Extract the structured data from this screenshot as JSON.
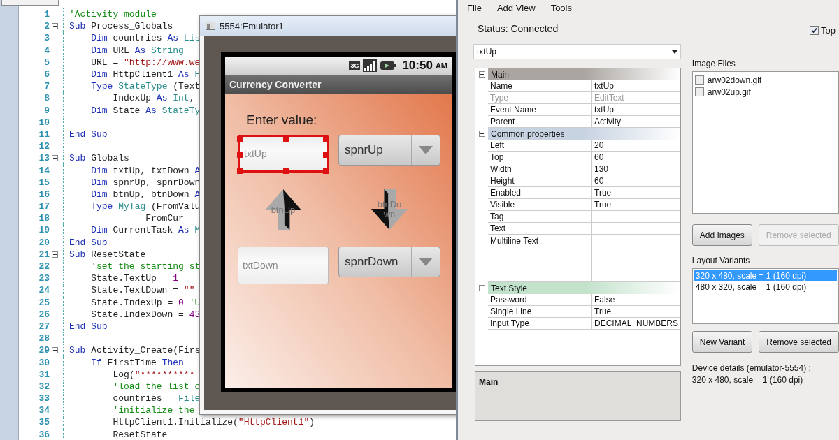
{
  "editor": {
    "lines": [
      {
        "number": "1",
        "fold": false,
        "tokens": [
          {
            "kind": "comment",
            "text": "'Activity module"
          }
        ]
      },
      {
        "number": "2",
        "fold": true,
        "tokens": [
          {
            "kind": "kw",
            "text": "Sub"
          },
          {
            "kind": "plain",
            "text": " Process_Globals"
          }
        ]
      },
      {
        "number": "3",
        "fold": false,
        "tokens": [
          {
            "kind": "kw",
            "text": "    Dim"
          },
          {
            "kind": "plain",
            "text": " countries "
          },
          {
            "kind": "kw",
            "text": "As"
          },
          {
            "kind": "type",
            "text": " Lis"
          }
        ]
      },
      {
        "number": "4",
        "fold": false,
        "tokens": [
          {
            "kind": "kw",
            "text": "    Dim"
          },
          {
            "kind": "plain",
            "text": " URL "
          },
          {
            "kind": "kw",
            "text": "As"
          },
          {
            "kind": "type",
            "text": " String"
          }
        ]
      },
      {
        "number": "5",
        "fold": false,
        "tokens": [
          {
            "kind": "plain",
            "text": "    URL = "
          },
          {
            "kind": "str",
            "text": "\"http://www.we"
          }
        ]
      },
      {
        "number": "6",
        "fold": false,
        "tokens": [
          {
            "kind": "kw",
            "text": "    Dim"
          },
          {
            "kind": "plain",
            "text": " HttpClient1 "
          },
          {
            "kind": "kw",
            "text": "As"
          },
          {
            "kind": "type",
            "text": " H"
          }
        ]
      },
      {
        "number": "7",
        "fold": false,
        "tokens": [
          {
            "kind": "kw",
            "text": "    Type"
          },
          {
            "kind": "type",
            "text": " StateType"
          },
          {
            "kind": "plain",
            "text": " (Text"
          }
        ]
      },
      {
        "number": "8",
        "fold": false,
        "tokens": [
          {
            "kind": "plain",
            "text": "        IndexUp "
          },
          {
            "kind": "kw",
            "text": "As"
          },
          {
            "kind": "type",
            "text": " Int"
          },
          {
            "kind": "plain",
            "text": ","
          }
        ]
      },
      {
        "number": "9",
        "fold": false,
        "tokens": [
          {
            "kind": "kw",
            "text": "    Dim"
          },
          {
            "kind": "plain",
            "text": " State "
          },
          {
            "kind": "kw",
            "text": "As"
          },
          {
            "kind": "type",
            "text": " StateTy"
          }
        ]
      },
      {
        "number": "10",
        "fold": false
      },
      {
        "number": "11",
        "fold": false,
        "tokens": [
          {
            "kind": "kw",
            "text": "End Sub"
          }
        ]
      },
      {
        "number": "12",
        "fold": false
      },
      {
        "number": "13",
        "fold": true,
        "tokens": [
          {
            "kind": "kw",
            "text": "Sub"
          },
          {
            "kind": "plain",
            "text": " Globals"
          }
        ]
      },
      {
        "number": "14",
        "fold": false,
        "tokens": [
          {
            "kind": "kw",
            "text": "    Dim"
          },
          {
            "kind": "plain",
            "text": " txtUp, txtDown "
          },
          {
            "kind": "kw",
            "text": "A"
          }
        ]
      },
      {
        "number": "15",
        "fold": false,
        "tokens": [
          {
            "kind": "kw",
            "text": "    Dim"
          },
          {
            "kind": "plain",
            "text": " spnrUp, spnrDown"
          }
        ]
      },
      {
        "number": "16",
        "fold": false,
        "tokens": [
          {
            "kind": "kw",
            "text": "    Dim"
          },
          {
            "kind": "plain",
            "text": " btnUp, btnDown "
          },
          {
            "kind": "kw",
            "text": "A"
          }
        ]
      },
      {
        "number": "17",
        "fold": false,
        "tokens": [
          {
            "kind": "kw",
            "text": "    Type"
          },
          {
            "kind": "type",
            "text": " MyTag"
          },
          {
            "kind": "plain",
            "text": " (FromValu"
          }
        ]
      },
      {
        "number": "18",
        "fold": false,
        "tokens": [
          {
            "kind": "plain",
            "text": "              FromCur"
          }
        ]
      },
      {
        "number": "19",
        "fold": false,
        "tokens": [
          {
            "kind": "kw",
            "text": "    Dim"
          },
          {
            "kind": "plain",
            "text": " CurrentTask "
          },
          {
            "kind": "kw",
            "text": "As"
          },
          {
            "kind": "type",
            "text": " M"
          }
        ]
      },
      {
        "number": "20",
        "fold": false,
        "tokens": [
          {
            "kind": "kw",
            "text": "End Sub"
          }
        ]
      },
      {
        "number": "21",
        "fold": true,
        "tokens": [
          {
            "kind": "kw",
            "text": "Sub"
          },
          {
            "kind": "plain",
            "text": " ResetState"
          }
        ]
      },
      {
        "number": "22",
        "fold": false,
        "tokens": [
          {
            "kind": "comment",
            "text": "    'set the starting st"
          }
        ]
      },
      {
        "number": "23",
        "fold": false,
        "tokens": [
          {
            "kind": "plain",
            "text": "    State.TextUp = "
          },
          {
            "kind": "num",
            "text": "1"
          }
        ]
      },
      {
        "number": "24",
        "fold": false,
        "tokens": [
          {
            "kind": "plain",
            "text": "    State.TextDown = "
          },
          {
            "kind": "str",
            "text": "\"\""
          }
        ]
      },
      {
        "number": "25",
        "fold": false,
        "tokens": [
          {
            "kind": "plain",
            "text": "    State.IndexUp = "
          },
          {
            "kind": "num",
            "text": "0"
          },
          {
            "kind": "comment",
            "text": " 'U"
          }
        ]
      },
      {
        "number": "26",
        "fold": false,
        "tokens": [
          {
            "kind": "plain",
            "text": "    State.IndexDown = "
          },
          {
            "kind": "num",
            "text": "43"
          }
        ]
      },
      {
        "number": "27",
        "fold": false,
        "tokens": [
          {
            "kind": "kw",
            "text": "End Sub"
          }
        ]
      },
      {
        "number": "28",
        "fold": false
      },
      {
        "number": "29",
        "fold": true,
        "tokens": [
          {
            "kind": "kw",
            "text": "Sub"
          },
          {
            "kind": "plain",
            "text": " Activity_Create(Firs"
          }
        ]
      },
      {
        "number": "30",
        "fold": false,
        "tokens": [
          {
            "kind": "kw",
            "text": "    If"
          },
          {
            "kind": "plain",
            "text": " FirstTime "
          },
          {
            "kind": "kw",
            "text": "Then"
          }
        ]
      },
      {
        "number": "31",
        "fold": false,
        "tokens": [
          {
            "kind": "plain",
            "text": "        Log("
          },
          {
            "kind": "str",
            "text": "\"**********"
          }
        ]
      },
      {
        "number": "32",
        "fold": false,
        "tokens": [
          {
            "kind": "comment",
            "text": "        'load the list o"
          }
        ]
      },
      {
        "number": "33",
        "fold": false,
        "tokens": [
          {
            "kind": "plain",
            "text": "        countries = "
          },
          {
            "kind": "type",
            "text": "File"
          }
        ]
      },
      {
        "number": "34",
        "fold": false,
        "tokens": [
          {
            "kind": "comment",
            "text": "        'initialize the"
          }
        ]
      },
      {
        "number": "35",
        "fold": false,
        "tokens": [
          {
            "kind": "plain",
            "text": "        HttpClient1.Initialize("
          },
          {
            "kind": "str",
            "text": "\"HttpClient1\""
          },
          {
            "kind": "plain",
            "text": ")"
          }
        ]
      },
      {
        "number": "36",
        "fold": false,
        "tokens": [
          {
            "kind": "plain",
            "text": "        ResetState"
          }
        ]
      }
    ]
  },
  "emulator": {
    "title": "5554:Emulator1",
    "network": "3G",
    "time": "10:50",
    "ampm": "AM",
    "app_title": "Currency Converter",
    "label": "Enter value:",
    "views": [
      {
        "kind": "edittext",
        "text": "txtUp",
        "selected": true
      },
      {
        "kind": "spinner",
        "text": "spnrUp",
        "selected": false
      },
      {
        "kind": "imageup",
        "text": "btnUp",
        "selected": false
      },
      {
        "kind": "imagedown",
        "text": "btnDown",
        "selected": false
      },
      {
        "kind": "edittext",
        "text": "txtDown",
        "selected": false
      },
      {
        "kind": "spinner",
        "text": "spnrDown",
        "selected": false
      }
    ]
  },
  "designer": {
    "menu": [
      "File",
      "Add View",
      "Tools"
    ],
    "status": "Status: Connected",
    "top_checkbox": {
      "label": "Top",
      "checked": true
    },
    "view_select": "txtUp",
    "properties": [
      {
        "kind": "category",
        "label": "Main",
        "expanded": true,
        "color": "#aaa5a0"
      },
      {
        "kind": "row",
        "name": "Name",
        "value": "txtUp",
        "disabled": false
      },
      {
        "kind": "row",
        "name": "Type",
        "value": "EditText",
        "disabled": true
      },
      {
        "kind": "row",
        "name": "Event Name",
        "value": "txtUp",
        "disabled": false
      },
      {
        "kind": "row",
        "name": "Parent",
        "value": "Activity",
        "disabled": false
      },
      {
        "kind": "category",
        "label": "Common properties",
        "expanded": true,
        "color": "#c8d3e2"
      },
      {
        "kind": "row",
        "name": "Left",
        "value": "20",
        "disabled": false
      },
      {
        "kind": "row",
        "name": "Top",
        "value": "60",
        "disabled": false
      },
      {
        "kind": "row",
        "name": "Width",
        "value": "130",
        "disabled": false
      },
      {
        "kind": "row",
        "name": "Height",
        "value": "60",
        "disabled": false
      },
      {
        "kind": "row",
        "name": "Enabled",
        "value": "True",
        "disabled": false
      },
      {
        "kind": "row",
        "name": "Visible",
        "value": "True",
        "disabled": false
      },
      {
        "kind": "row",
        "name": "Tag",
        "disabled": false
      },
      {
        "kind": "row",
        "name": "Text",
        "disabled": false
      },
      {
        "kind": "multiline",
        "name": "Multiline Text",
        "disabled": false
      },
      {
        "kind": "category",
        "label": "Text Style",
        "expanded": false,
        "color": "#c2e2cb"
      },
      {
        "kind": "row",
        "name": "Password",
        "value": "False",
        "disabled": false
      },
      {
        "kind": "row",
        "name": "Single Line",
        "value": "True",
        "disabled": false
      },
      {
        "kind": "row",
        "name": "Input Type",
        "value": "DECIMAL_NUMBERS",
        "disabled": false
      }
    ],
    "description_title": "Main",
    "image_files_label": "Image Files",
    "image_files": [
      {
        "name": "arw02down.gif",
        "checked": false
      },
      {
        "name": "arw02up.gif",
        "checked": false
      }
    ],
    "image_buttons": [
      {
        "label": "Add Images",
        "disabled": false
      },
      {
        "label": "Remove selected",
        "disabled": true
      }
    ],
    "variants_label": "Layout Variants",
    "variants": [
      {
        "label": "320 x 480, scale = 1 (160 dpi)",
        "selected": true
      },
      {
        "label": "480 x 320, scale = 1 (160 dpi)",
        "selected": false
      }
    ],
    "variant_buttons": [
      {
        "label": "New Variant",
        "disabled": false
      },
      {
        "label": "Remove selected",
        "disabled": false
      }
    ],
    "device_details": [
      "Device details (emulator-5554) :",
      "320 x 480, scale = 1 (160 dpi)"
    ]
  }
}
